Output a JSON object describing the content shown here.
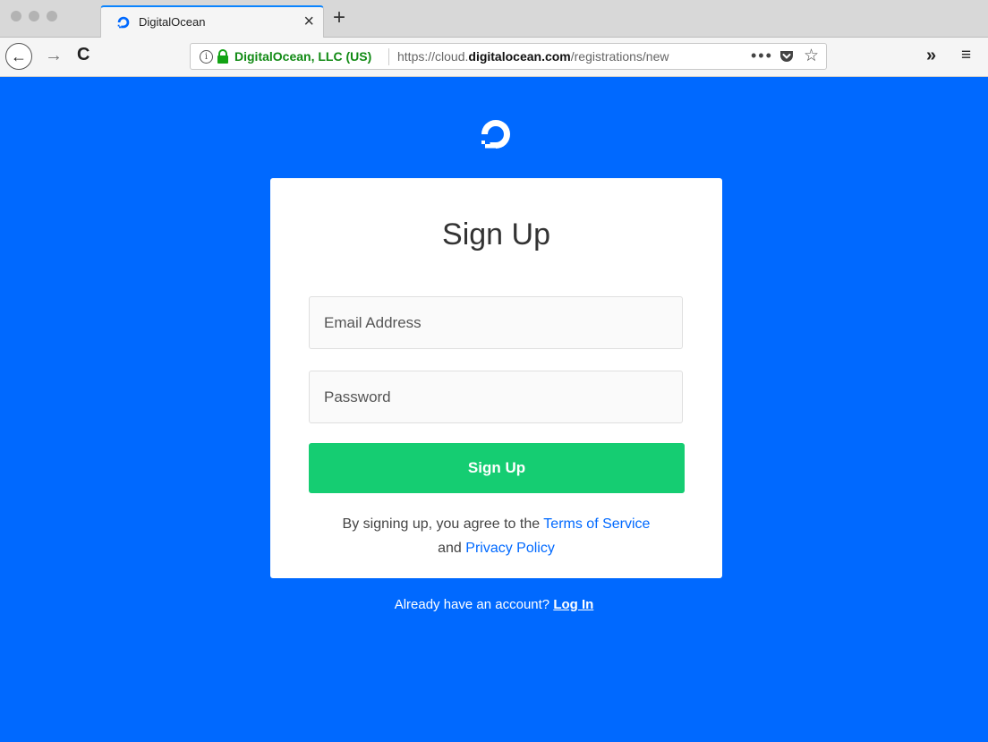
{
  "browser": {
    "tab": {
      "title": "DigitalOcean",
      "close_glyph": "×",
      "favicon": "digitalocean-logo-icon"
    },
    "new_tab_glyph": "+",
    "nav": {
      "back_glyph": "←",
      "forward_glyph": "→",
      "reload_glyph": "C"
    },
    "urlbar": {
      "info_glyph": "i",
      "identity": "DigitalOcean, LLC (US)",
      "url_prefix": "https://cloud.",
      "url_domain": "digitalocean.com",
      "url_path": "/registrations/new",
      "page_actions_glyph": "•••",
      "star_glyph": "☆"
    },
    "overflow_glyph": "»",
    "menu_glyph": "≡"
  },
  "page": {
    "background_color": "#0069ff",
    "card": {
      "title": "Sign Up",
      "email_placeholder": "Email Address",
      "email_value": "",
      "password_placeholder": "Password",
      "password_value": "",
      "submit_label": "Sign Up",
      "submit_color": "#15cd72",
      "terms_prefix": "By signing up, you agree to the",
      "terms_link": "Terms of Service",
      "terms_and": "and",
      "privacy_link": "Privacy Policy"
    },
    "login_prompt": "Already have an account?",
    "login_link": "Log In"
  }
}
